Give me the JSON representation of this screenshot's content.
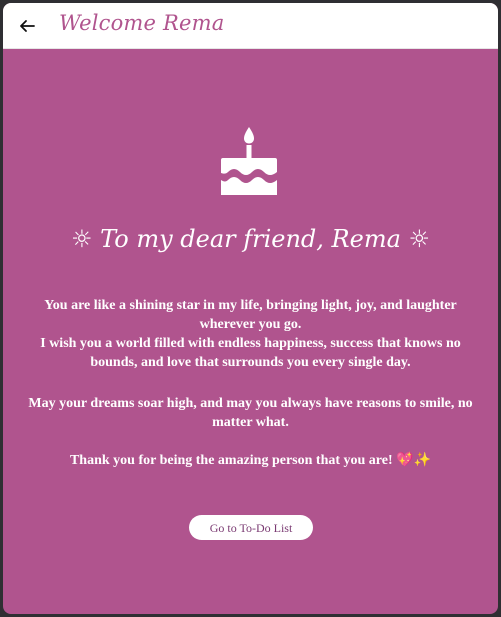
{
  "appbar": {
    "title": "Welcome Rema",
    "back_icon": "arrow-left-icon"
  },
  "hero": {
    "icon": "birthday-cake-icon",
    "heading": "☼ To my dear friend, Rema ☼"
  },
  "message": {
    "paragraph1_line1": "You are like a shining star in my life, bringing light, joy, and laughter wherever you go.",
    "paragraph1_line2": "I wish you a world filled with endless happiness, success that knows no bounds, and love that surrounds you every single day.",
    "paragraph2": "May your dreams soar high, and may you always have reasons to smile, no matter what.",
    "paragraph3": "Thank you for being the amazing person that you are! 💖✨"
  },
  "actions": {
    "todo_label": "Go to To-Do List"
  },
  "colors": {
    "background": "#b0548e",
    "appbar": "#ffffff",
    "title": "#b0548e",
    "button_text": "#7a3a72"
  }
}
